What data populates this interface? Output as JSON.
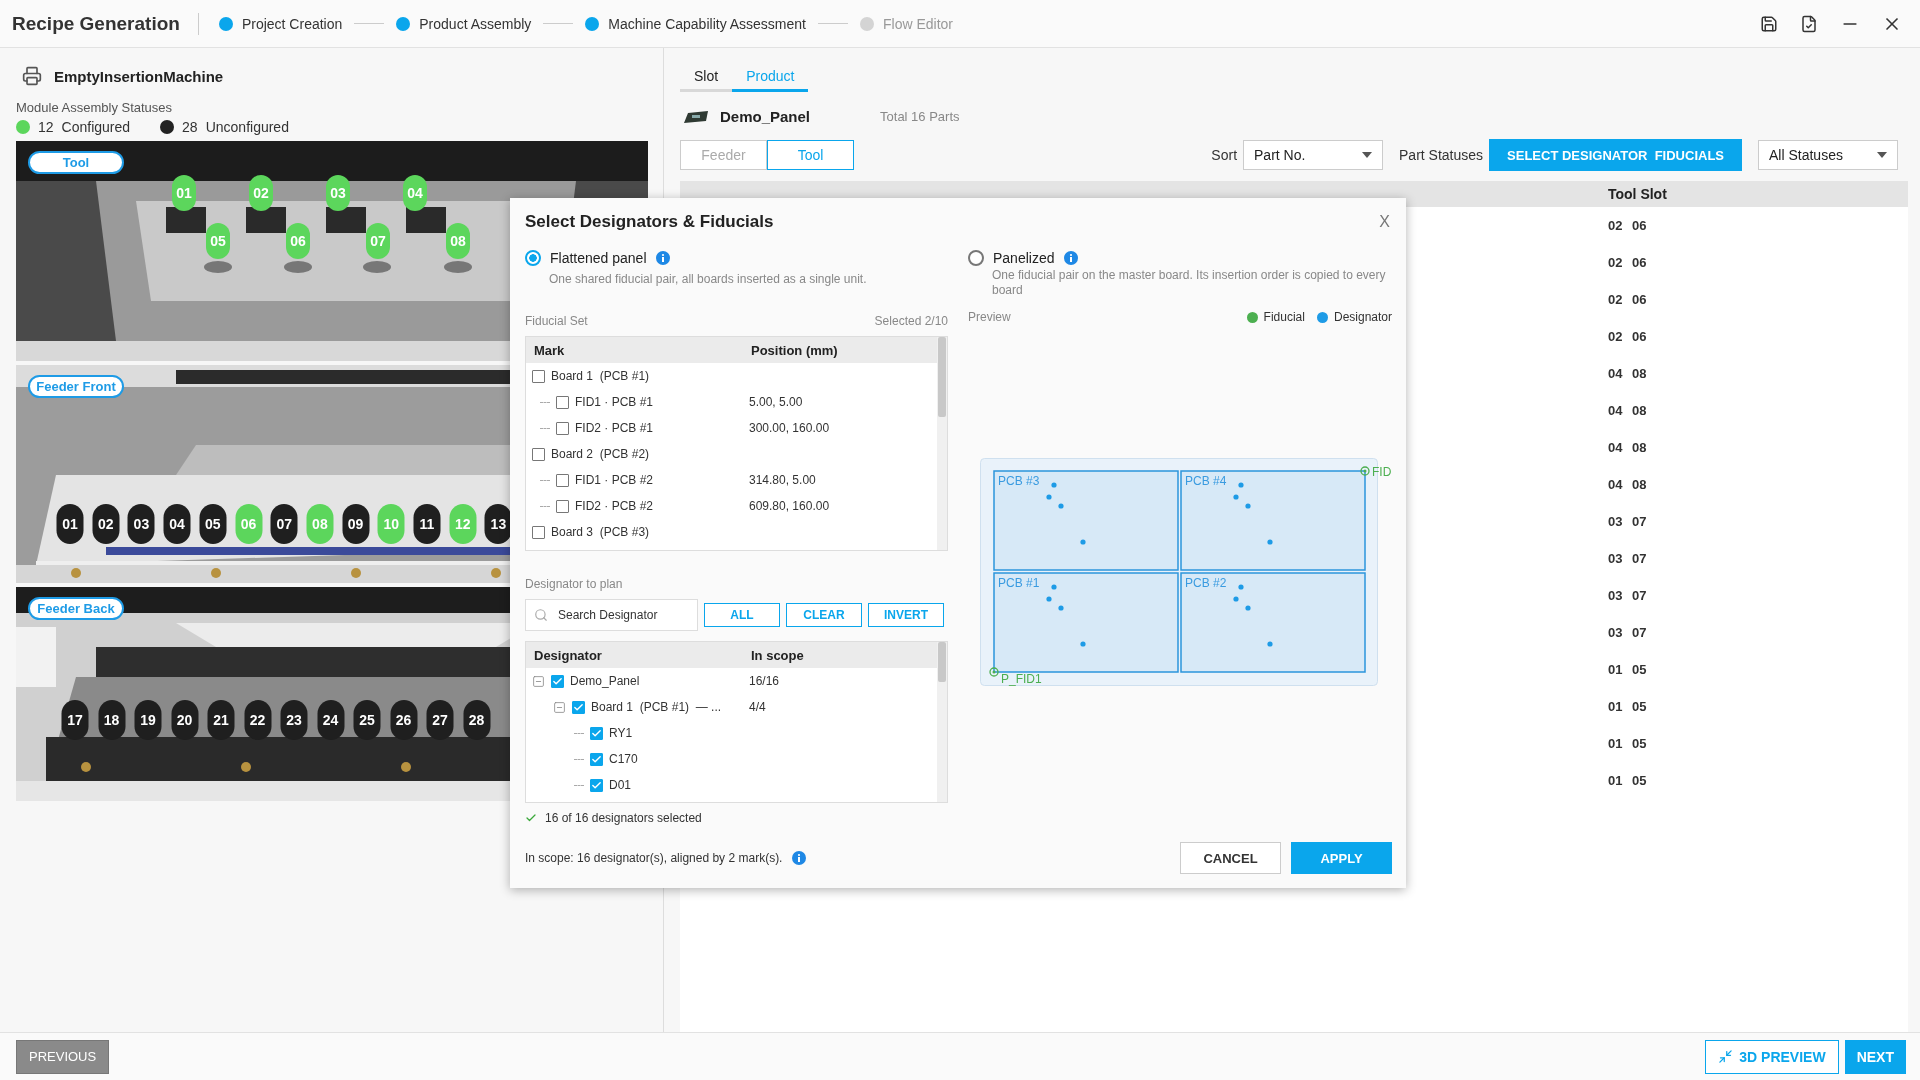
{
  "header": {
    "title": "Recipe Generation",
    "steps": [
      {
        "label": "Project Creation",
        "done": true
      },
      {
        "label": "Product Assembly",
        "done": true
      },
      {
        "label": "Machine Capability Assessment",
        "done": true
      },
      {
        "label": "Flow Editor",
        "done": false
      }
    ]
  },
  "machine": {
    "name": "EmptyInsertionMachine",
    "statuses_title": "Module Assembly Statuses",
    "configured_count": "12",
    "configured_label": "Configured",
    "unconfigured_count": "28",
    "unconfigured_label": "Unconfigured"
  },
  "views": [
    {
      "kind": "tool",
      "label": "Tool",
      "slots": [
        {
          "number": "01",
          "configured": true
        },
        {
          "number": "02",
          "configured": true
        },
        {
          "number": "03",
          "configured": true
        },
        {
          "number": "04",
          "configured": true
        },
        {
          "number": "05",
          "configured": true
        },
        {
          "number": "06",
          "configured": true
        },
        {
          "number": "07",
          "configured": true
        },
        {
          "number": "08",
          "configured": true
        }
      ]
    },
    {
      "kind": "front",
      "label": "Feeder Front",
      "slots": [
        {
          "number": "01",
          "configured": false
        },
        {
          "number": "02",
          "configured": false
        },
        {
          "number": "03",
          "configured": false
        },
        {
          "number": "04",
          "configured": false
        },
        {
          "number": "05",
          "configured": false
        },
        {
          "number": "06",
          "configured": true
        },
        {
          "number": "07",
          "configured": false
        },
        {
          "number": "08",
          "configured": true
        },
        {
          "number": "09",
          "configured": false
        },
        {
          "number": "10",
          "configured": true
        },
        {
          "number": "11",
          "configured": false
        },
        {
          "number": "12",
          "configured": true
        },
        {
          "number": "13",
          "configured": false
        }
      ]
    },
    {
      "kind": "back",
      "label": "Feeder Back",
      "slots": [
        {
          "number": "17",
          "configured": false
        },
        {
          "number": "18",
          "configured": false
        },
        {
          "number": "19",
          "configured": false
        },
        {
          "number": "20",
          "configured": false
        },
        {
          "number": "21",
          "configured": false
        },
        {
          "number": "22",
          "configured": false
        },
        {
          "number": "23",
          "configured": false
        },
        {
          "number": "24",
          "configured": false
        },
        {
          "number": "25",
          "configured": false
        },
        {
          "number": "26",
          "configured": false
        },
        {
          "number": "27",
          "configured": false
        },
        {
          "number": "28",
          "configured": false
        }
      ]
    }
  ],
  "tabs": [
    {
      "label": "Slot",
      "selected": false
    },
    {
      "label": "Product",
      "selected": true
    }
  ],
  "product": {
    "name": "Demo_Panel",
    "total": "Total 16 Parts"
  },
  "modes": [
    {
      "label": "Feeder",
      "selected": false
    },
    {
      "label": "Tool",
      "selected": true
    }
  ],
  "sort": {
    "label": "Sort",
    "value": "Part No."
  },
  "part_statuses_label": "Part Statuses",
  "select_button": "SELECT DESIGNATOR  FIDUCIALS",
  "status_filter": "All Statuses",
  "table": {
    "columns": [
      "Tool Slot"
    ],
    "rows": [
      "02 06",
      "02 06",
      "02 06",
      "02 06",
      "04 08",
      "04 08",
      "04 08",
      "04 08",
      "03 07",
      "03 07",
      "03 07",
      "03 07",
      "01 05",
      "01 05",
      "01 05",
      "01 05"
    ]
  },
  "dialog": {
    "title": "Select Designators & Fiducials",
    "close": "X",
    "modes": [
      {
        "label": "Flattened panel",
        "description": "One shared fiducial pair, all boards inserted as a single unit.",
        "selected": true
      },
      {
        "label": "Panelized",
        "description": "One fiducial pair on the master board. Its insertion order is copied to every board",
        "selected": false
      }
    ],
    "fiducial_set": {
      "title": "Fiducial Set",
      "count": "Selected 2/10",
      "columns": [
        "Mark",
        "Position (mm)"
      ],
      "rows": [
        {
          "mark": "Board 1  (PCB #1)",
          "checked": false,
          "children": [
            {
              "mark": "FID1 · PCB #1",
              "position": "5.00, 5.00",
              "checked": false
            },
            {
              "mark": "FID2 · PCB #1",
              "position": "300.00, 160.00",
              "checked": false
            }
          ]
        },
        {
          "mark": "Board 2  (PCB #2)",
          "checked": false,
          "children": [
            {
              "mark": "FID1 · PCB #2",
              "position": "314.80, 5.00",
              "checked": false
            },
            {
              "mark": "FID2 · PCB #2",
              "position": "609.80, 160.00",
              "checked": false
            }
          ]
        },
        {
          "mark": "Board 3  (PCB #3)",
          "checked": false
        }
      ]
    },
    "designators": {
      "title": "Designator to plan",
      "search": {
        "placeholder": "Search Designator"
      },
      "actions": [
        "ALL",
        "CLEAR",
        "INVERT"
      ],
      "columns": [
        "Designator",
        "In scope"
      ],
      "tree": [
        {
          "name": "Demo_Panel",
          "scope": "16/16",
          "checked": true,
          "expanded": true,
          "children": [
            {
              "name": "Board 1  (PCB #1)  — ...",
              "scope": "4/4",
              "checked": true,
              "expanded": true,
              "children": [
                {
                  "name": "RY1",
                  "checked": true
                },
                {
                  "name": "C170",
                  "checked": true
                },
                {
                  "name": "D01",
                  "checked": true
                }
              ]
            }
          ]
        }
      ],
      "summary": "16 of 16 designators selected"
    },
    "preview": {
      "title": "Preview",
      "legend": [
        {
          "label": "Fiducial",
          "color": "#4caf50"
        },
        {
          "label": "Designator",
          "color": "#1e9be6"
        }
      ],
      "boards": [
        "PCB #3",
        "PCB #4",
        "PCB #1",
        "PCB #2"
      ],
      "fiducials": [
        "FID",
        "P_FID1"
      ]
    },
    "scope_note": "In scope: 16 designator(s), aligned by 2 mark(s).",
    "buttons": [
      {
        "label": "CANCEL",
        "kind": "secondary"
      },
      {
        "label": "APPLY",
        "kind": "primary"
      }
    ]
  },
  "footer": {
    "previous": "PREVIOUS",
    "preview_3d": "3D PREVIEW",
    "next": "NEXT"
  }
}
